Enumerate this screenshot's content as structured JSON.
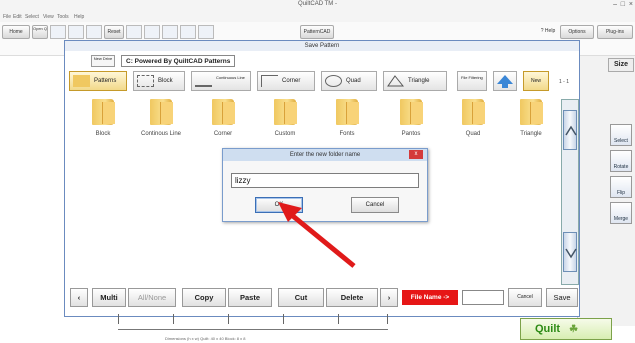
{
  "app": {
    "title": "QuiltCAD TM -",
    "menu": [
      "File",
      "Edit",
      "Select",
      "View",
      "Tools",
      "Help"
    ],
    "toolbar": [
      "Home",
      "Open Quilt",
      "Reset",
      "PatternCAD"
    ],
    "toolbar_right": [
      "? Help",
      "Options",
      "Plug-ins"
    ],
    "size_label": "Size"
  },
  "side_tools": [
    {
      "label": "Select"
    },
    {
      "label": "Rotate"
    },
    {
      "label": "Flip"
    },
    {
      "label": "Merge"
    }
  ],
  "save_dialog": {
    "title": "Save Pattern",
    "new_drive": "New Drive",
    "path": "C:  Powered By QuiltCAD  Patterns",
    "filters": [
      "Patterns",
      "Block",
      "Continuous Line",
      "Corner",
      "Quad",
      "Triangle"
    ],
    "file_filtering": "File Filtering",
    "new_label": "New",
    "page_indicator": "1 - 1",
    "folders": [
      "Block",
      "Continous Line",
      "Corner",
      "Custom",
      "Fonts",
      "Pantos",
      "Quad",
      "Triangle"
    ],
    "actions": {
      "multi": "Multi",
      "all_none": "All/None",
      "copy": "Copy",
      "paste": "Paste",
      "cut": "Cut",
      "delete": "Delete",
      "file_name_label": "File Name ->",
      "cancel": "Cancel",
      "save": "Save"
    }
  },
  "folder_prompt": {
    "title": "Enter the new folder name",
    "value": "lizzy",
    "ok": "OK",
    "cancel": "Cancel",
    "close": "x"
  },
  "status": "Dimensions (h x w)   Quilt: 40 x 40   Block: 8 x 8",
  "quilt_button": "Quilt",
  "colors": {
    "accent_red": "#e61616",
    "quilt_green": "#2c8a14",
    "folder_yellow": "#f0c860"
  }
}
